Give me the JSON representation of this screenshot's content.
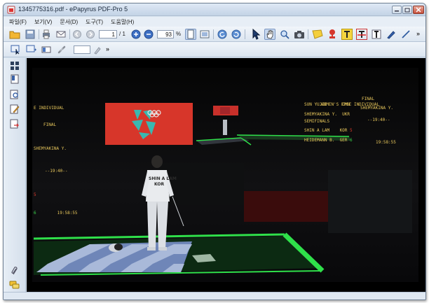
{
  "window": {
    "title": "1345775316.pdf - ePapyrus PDF-Pro 5"
  },
  "menu": {
    "items": [
      "파일(F)",
      "보기(V)",
      "문서(D)",
      "도구(T)",
      "도움말(H)"
    ]
  },
  "toolbar": {
    "page_current": "1",
    "page_total": "/ 1",
    "zoom_value": "93",
    "zoom_unit": "%",
    "more_label": "»"
  },
  "toolbar2": {
    "more_label": "»"
  },
  "scene": {
    "left_board": {
      "line1": "E INDIVIDUAL",
      "line2": "FINAL",
      "line3": "SHEMYAKINA Y.",
      "line4": "--19:40--",
      "score_red": "5",
      "score_green": "6",
      "clock": "19:58:55"
    },
    "right_board": {
      "title1": "WOMEN'S EPEE INDIVIDUAL",
      "title2": "SEMIFINALS",
      "title3": "FINAL",
      "row1": "SUN YUJIE      CHN",
      "row2": "SHEMYAKINA Y.  UKR",
      "right1": "SHEMYAKINA Y.",
      "right2": "--19:40--",
      "row3_name": "SHIN A LAM    KOR",
      "row3_score": "5",
      "row4_name": "HEIDEMANN B.  GER",
      "row4_score": "6",
      "clock": "19:58:55"
    },
    "fencer_back": "SHIN A LAM",
    "fencer_country": "KOR"
  },
  "colors": {
    "accent_green": "#2fe04a",
    "banner_red": "#d7362a",
    "scoreboard_yellow": "#e9c85c"
  }
}
